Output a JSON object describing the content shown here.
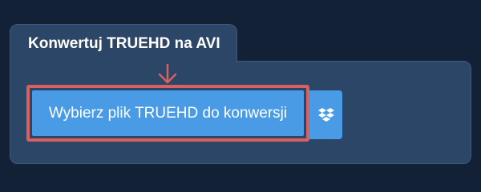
{
  "converter": {
    "title": "Konwertuj TRUEHD na AVI",
    "select_file_label": "Wybierz plik TRUEHD do konwersji",
    "dropbox_icon": "dropbox-icon",
    "pointer_icon": "arrow-down-icon"
  },
  "colors": {
    "page_background": "#122136",
    "panel_background": "#2c4668",
    "button_blue": "#4a9be6",
    "highlight_red": "#d9605e"
  }
}
